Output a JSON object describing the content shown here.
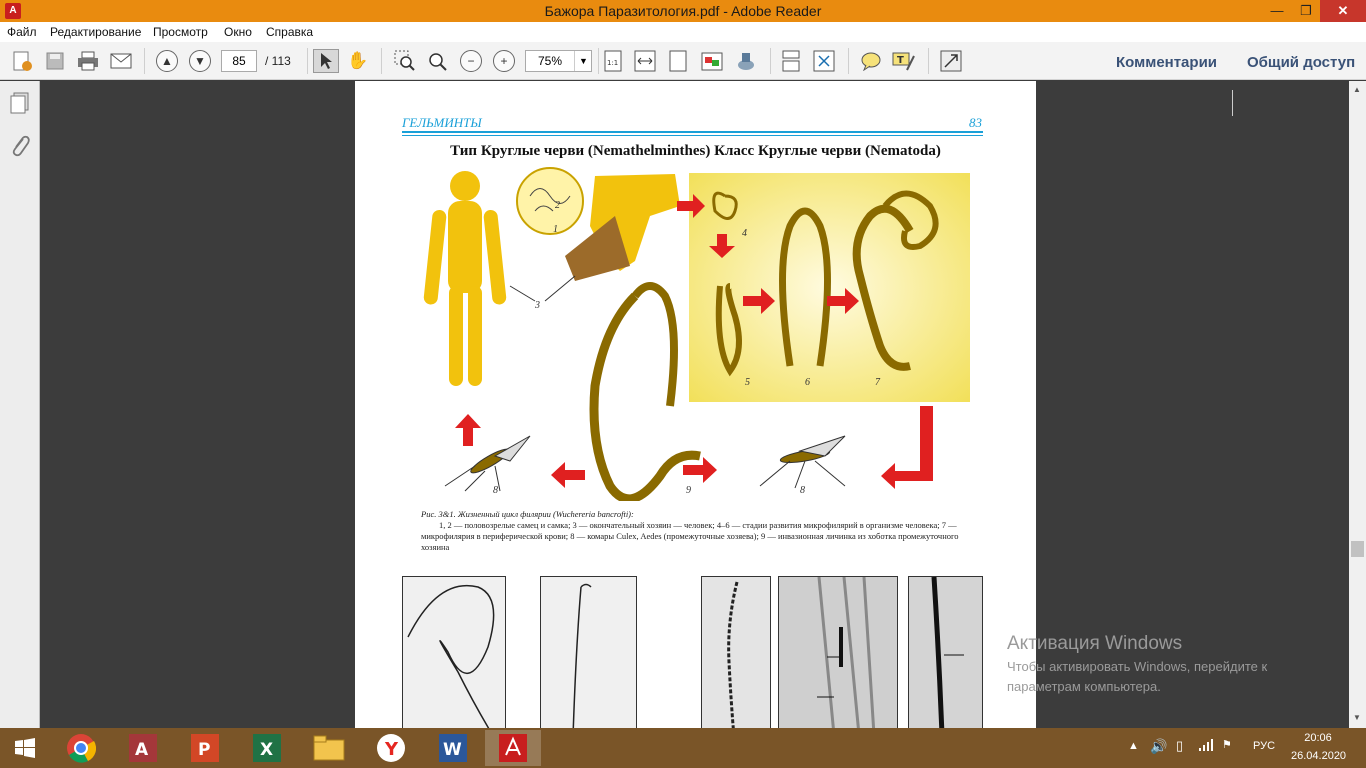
{
  "window": {
    "title": "Бажора Паразитология.pdf - Adobe Reader",
    "minimize": "—",
    "maximize": "❐",
    "close": "✕"
  },
  "menu": [
    "Файл",
    "Редактирование",
    "Просмотр",
    "Окно",
    "Справка"
  ],
  "toolbar": {
    "page_current": "85",
    "page_total": "/ 113",
    "zoom": "75%",
    "comments": "Комментарии",
    "share": "Общий доступ"
  },
  "page": {
    "header_title": "ГЕЛЬМИНТЫ",
    "header_page": "83",
    "section_title": "Тип Круглые черви (Nemathelminthes) Класс Круглые черви (Nematoda)",
    "figure_labels": [
      "1",
      "2",
      "3",
      "4",
      "5",
      "6",
      "7",
      "8",
      "9",
      "8"
    ],
    "caption_title": "Рис. 3&1. Жизненный цикл филярии (Wuchereria bancrofti):",
    "caption_body": "1, 2 — половозрелые самец и самка; 3 — окончательный хозяин — человек; 4–6 — стадии развития микрофилярий в организме человека; 7 — микрофилярия в периферической крови; 8 — комары Culex, Aedes (промежуточные хозяева); 9 — инвазионная личинка из хоботка промежуточного хозяина"
  },
  "activation": {
    "title": "Активация Windows",
    "subtitle": "Чтобы активировать Windows, перейдите к параметрам компьютера."
  },
  "taskbar": {
    "language": "РУС",
    "time": "20:06",
    "date": "26.04.2020",
    "apps": [
      "start",
      "chrome",
      "access",
      "powerpoint",
      "excel",
      "file-explorer",
      "yandex",
      "word",
      "adobe-reader"
    ]
  },
  "colors": {
    "titlebar": "#e98b0f",
    "taskbar": "#7a5528",
    "header_blue": "#1aa0d8",
    "arrow_red": "#e02020",
    "figure_yellow": "#f2c20d"
  }
}
